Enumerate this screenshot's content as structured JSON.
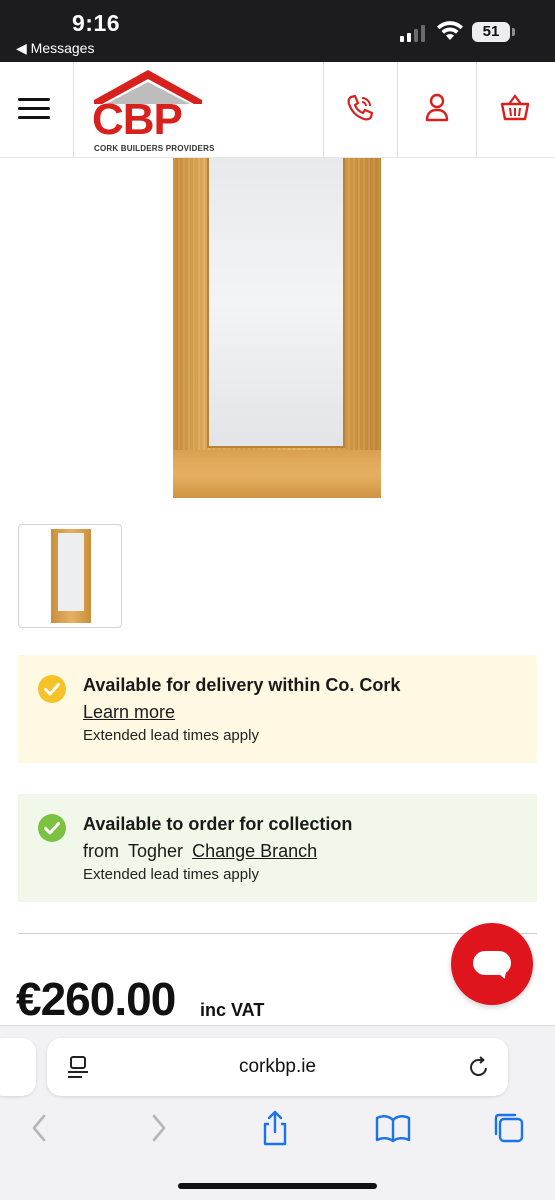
{
  "status_bar": {
    "time": "9:16",
    "back_label": "◀ Messages",
    "battery": "51"
  },
  "header": {
    "logo_text": "CBP",
    "logo_subtitle": "CORK BUILDERS PROVIDERS",
    "brand_color": "#d8211c",
    "icons": [
      "menu-icon",
      "phone-icon",
      "account-icon",
      "basket-icon"
    ]
  },
  "delivery": {
    "title": "Available for delivery within Co. Cork",
    "link": "Learn more",
    "note": "Extended lead times apply",
    "icon_color": "#f5c228"
  },
  "collection": {
    "title": "Available to order for collection",
    "from_label": "from",
    "branch": "Togher",
    "change_link": "Change Branch",
    "note": "Extended lead times apply",
    "icon_color": "#7cc242"
  },
  "price": {
    "amount": "€260.00",
    "vat_label": "inc VAT"
  },
  "browser": {
    "url": "corkbp.ie"
  }
}
